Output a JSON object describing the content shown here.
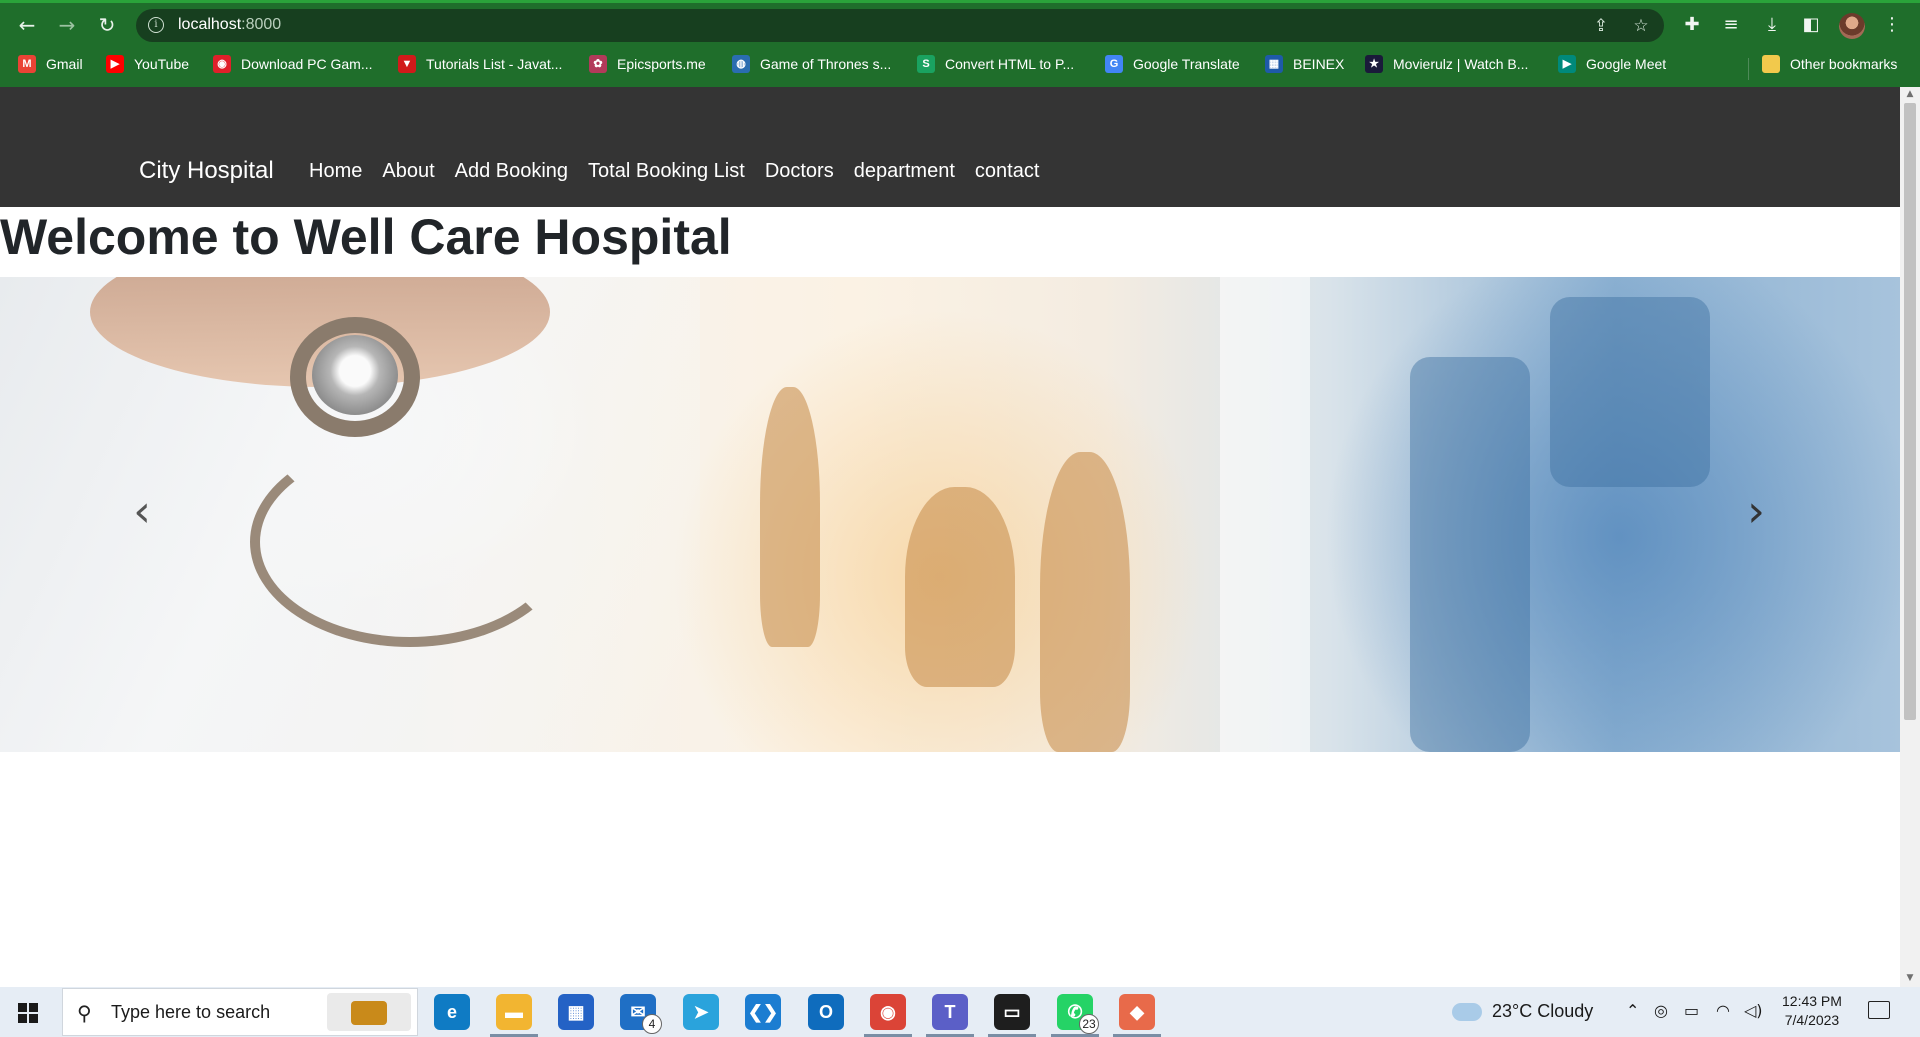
{
  "browser": {
    "url_host": "localhost",
    "url_port": ":8000",
    "bookmarks": [
      {
        "label": "Gmail",
        "icon": "gmail-icon",
        "color": "#ea4335",
        "glyph": "M"
      },
      {
        "label": "YouTube",
        "icon": "youtube-icon",
        "color": "#ff0000",
        "glyph": "▶"
      },
      {
        "label": "Download PC Gam...",
        "icon": "game-icon",
        "color": "#e0202a",
        "glyph": "◉"
      },
      {
        "label": "Tutorials List - Javat...",
        "icon": "javatpoint-icon",
        "color": "#d11a1a",
        "glyph": "▼"
      },
      {
        "label": "Epicsports.me",
        "icon": "epicsports-icon",
        "color": "#b23a5a",
        "glyph": "✿"
      },
      {
        "label": "Game of Thrones s...",
        "icon": "globe-icon",
        "color": "#2a6db0",
        "glyph": "◍"
      },
      {
        "label": "Convert HTML to P...",
        "icon": "convert-icon",
        "color": "#1aa260",
        "glyph": "S"
      },
      {
        "label": "Google Translate",
        "icon": "translate-icon",
        "color": "#4285f4",
        "glyph": "G"
      },
      {
        "label": "BEINEX",
        "icon": "beinex-icon",
        "color": "#1e5aa8",
        "glyph": "▦"
      },
      {
        "label": "Movierulz | Watch B...",
        "icon": "movierulz-icon",
        "color": "#1a1a3a",
        "glyph": "★"
      },
      {
        "label": "Google Meet",
        "icon": "meet-icon",
        "color": "#00897b",
        "glyph": "▶"
      }
    ],
    "other_bookmarks": "Other bookmarks"
  },
  "site": {
    "brand": "City Hospital",
    "nav": [
      "Home",
      "About",
      "Add Booking",
      "Total Booking List",
      "Doctors",
      "department",
      "contact"
    ],
    "heading": "Welcome to Well Care Hospital",
    "carousel": {
      "prev_glyph": "‹",
      "next_glyph": "›",
      "slides": 3,
      "active_index": 0
    }
  },
  "taskbar": {
    "search_placeholder": "Type here to search",
    "apps": [
      {
        "name": "edge-icon",
        "color": "#0f7bc4",
        "glyph": "e"
      },
      {
        "name": "file-explorer-icon",
        "color": "#f2b531",
        "glyph": "▬"
      },
      {
        "name": "store-icon",
        "color": "#2462c5",
        "glyph": "▦"
      },
      {
        "name": "mail-icon",
        "color": "#1f6fc5",
        "glyph": "✉",
        "badge": "4"
      },
      {
        "name": "telegram-icon",
        "color": "#2aa3dc",
        "glyph": "➤"
      },
      {
        "name": "vscode-icon",
        "color": "#1c7dd1",
        "glyph": "❮❯"
      },
      {
        "name": "outlook-icon",
        "color": "#0f6cbd",
        "glyph": "O"
      },
      {
        "name": "chrome-icon",
        "color": "#db4437",
        "glyph": "◉"
      },
      {
        "name": "teams-icon",
        "color": "#5b5fc7",
        "glyph": "T"
      },
      {
        "name": "terminal-icon",
        "color": "#1e1e1e",
        "glyph": "▭"
      },
      {
        "name": "whatsapp-icon",
        "color": "#25d366",
        "glyph": "✆",
        "badge": "23"
      },
      {
        "name": "git-icon",
        "color": "#e86a4a",
        "glyph": "◆"
      }
    ],
    "weather": "23°C  Cloudy",
    "time": "12:43 PM",
    "date": "7/4/2023"
  }
}
